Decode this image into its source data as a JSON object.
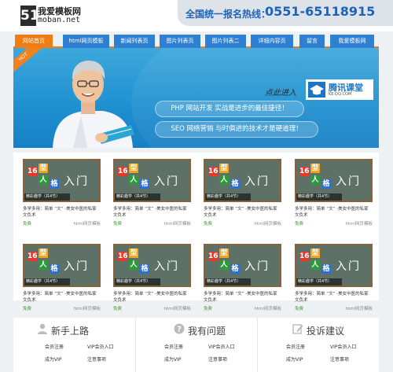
{
  "header": {
    "logo_text_cn": "我爱模板网",
    "logo_text_en": "moban.net",
    "logo_badge": "51",
    "hotline_label": "全国统一报名热线：",
    "hotline_number": "0551-65118915"
  },
  "nav": {
    "items": [
      {
        "label": "网站首页",
        "active": true
      },
      {
        "label": "html网页模板",
        "active": false
      },
      {
        "label": "新闻列表页",
        "active": false
      },
      {
        "label": "图片列表页",
        "active": false
      },
      {
        "label": "图片列表二",
        "active": false
      },
      {
        "label": "详细内容页",
        "active": false
      },
      {
        "label": "留言",
        "active": false
      },
      {
        "label": "我爱模板网",
        "active": false
      }
    ]
  },
  "banner": {
    "hot_label": "HOT",
    "enter_text": "点此进入",
    "brand_name": "腾讯课堂",
    "brand_url": "KE.QQ.COM",
    "pill1": "PHP 网站开发 实战是进步的最佳捷径！",
    "pill2": "SEO 网络营销 与时俱进的技术才是硬道理！"
  },
  "card_common": {
    "tile1": "16",
    "tile2": "型",
    "tile3": "人",
    "tile4": "格",
    "rumen": "入门",
    "caption": "精彩趣学（共4节）",
    "title": "多学多用：简单 “文” -美女中医的私家文负术",
    "free": "免费",
    "source": "html网页模板"
  },
  "cards": [
    {
      "id": 1
    },
    {
      "id": 2
    },
    {
      "id": 3
    },
    {
      "id": 4
    },
    {
      "id": 5
    },
    {
      "id": 6
    },
    {
      "id": 7
    },
    {
      "id": 8
    }
  ],
  "footer": {
    "col1": {
      "title": "新手上路",
      "links": [
        "会员注册",
        "VIP会员入口",
        "成为VIP",
        "注意事项"
      ]
    },
    "col2": {
      "title": "我有问题",
      "links": [
        "会员注册",
        "VIP会员入口",
        "成为VIP",
        "注意事项"
      ]
    },
    "col3": {
      "title": "投诉建议",
      "links": [
        "会员注册",
        "VIP会员入口",
        "成为VIP",
        "注意事项"
      ]
    }
  },
  "colors": {
    "accent_orange": "#f07d13",
    "nav_blue": "#2f7fd2",
    "hotline_blue": "#1f63b8",
    "free_green": "#3a9a2c"
  }
}
